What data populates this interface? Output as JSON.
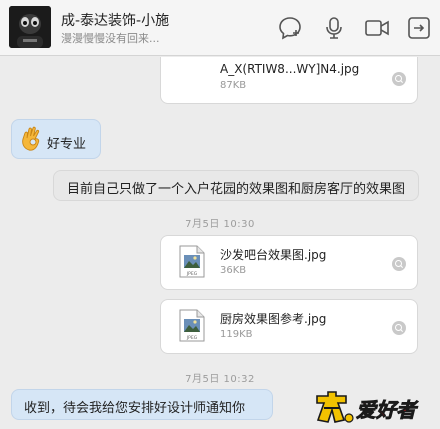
{
  "header": {
    "contact_name": "成-泰达装饰-小施",
    "status": "漫漫慢慢没有回来..."
  },
  "messages": {
    "file_partial": {
      "name": "A_X(RTIW8...WY]N4.jpg",
      "size": "87KB"
    },
    "reply_emoji_text": "好专业",
    "sent_text": "目前自己只做了一个入户花园的效果图和厨房客厅的效果图",
    "time1": "7月5日  10:30",
    "file1": {
      "name": "沙发吧台效果图.jpg",
      "size": "36KB"
    },
    "file2": {
      "name": "厨房效果图参考.jpg",
      "size": "119KB"
    },
    "time2": "7月5日  10:32",
    "last_reply": "收到，待会我给您安排好设计师通知你"
  },
  "watermark": {
    "text": "爱好者"
  },
  "colors": {
    "incoming_bubble": "#d6e6f6",
    "outgoing_bubble": "#e8e8e8",
    "background": "#ececec"
  }
}
